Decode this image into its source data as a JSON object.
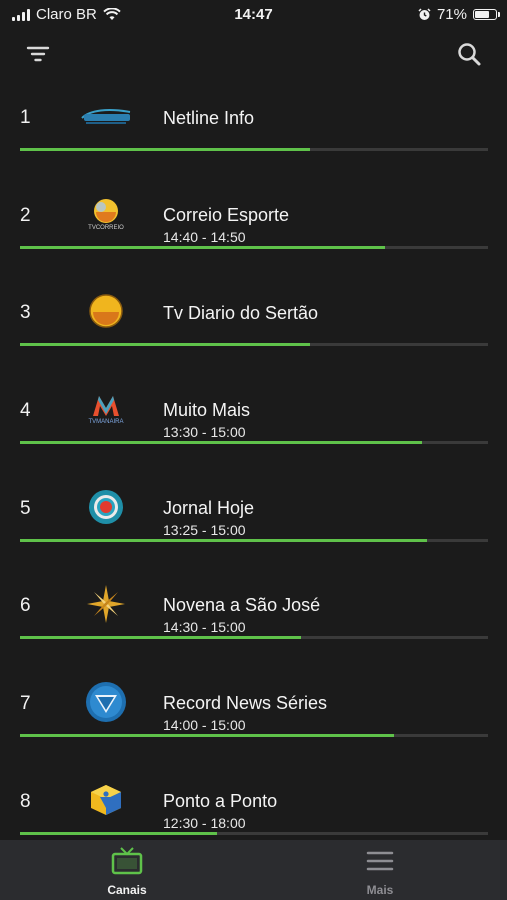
{
  "status_bar": {
    "carrier": "Claro BR",
    "time": "14:47",
    "battery": "71%",
    "battery_level": 0.71
  },
  "header": {
    "filter_icon": "filter-icon",
    "search_icon": "search-icon"
  },
  "channels": [
    {
      "number": "1",
      "name": "Netline Info",
      "time": "",
      "progress": 0.62,
      "logo": "netline-logo"
    },
    {
      "number": "2",
      "name": "Correio Esporte",
      "time": "14:40 - 14:50",
      "progress": 0.78,
      "logo": "tv-correio-logo",
      "logo_caption": "TVCORREIO"
    },
    {
      "number": "3",
      "name": "Tv Diario do Sertão",
      "time": "",
      "progress": 0.62,
      "logo": "tv-diario-logo"
    },
    {
      "number": "4",
      "name": "Muito Mais",
      "time": "13:30 - 15:00",
      "progress": 0.86,
      "logo": "tv-manaira-logo",
      "logo_caption": "TVMANAIRA"
    },
    {
      "number": "5",
      "name": "Jornal Hoje",
      "time": "13:25 - 15:00",
      "progress": 0.87,
      "logo": "globo-logo"
    },
    {
      "number": "6",
      "name": "Novena a São José",
      "time": "14:30 - 15:00",
      "progress": 0.6,
      "logo": "star-logo"
    },
    {
      "number": "7",
      "name": "Record News Séries",
      "time": "14:00 - 15:00",
      "progress": 0.8,
      "logo": "record-logo"
    },
    {
      "number": "8",
      "name": "Ponto a Ponto",
      "time": "12:30 - 18:00",
      "progress": 0.42,
      "logo": "cube-logo"
    }
  ],
  "tab_bar": {
    "tabs": [
      {
        "label": "Canais",
        "icon": "tv-icon",
        "active": true,
        "color": "#5fc24a"
      },
      {
        "label": "Mais",
        "icon": "menu-icon",
        "active": false,
        "color": "#8e8e93"
      }
    ]
  },
  "colors": {
    "accent": "#5fc24a",
    "background": "#1b1b1b",
    "tab_bar": "#2b2c2f",
    "track": "#3a3a3a"
  }
}
